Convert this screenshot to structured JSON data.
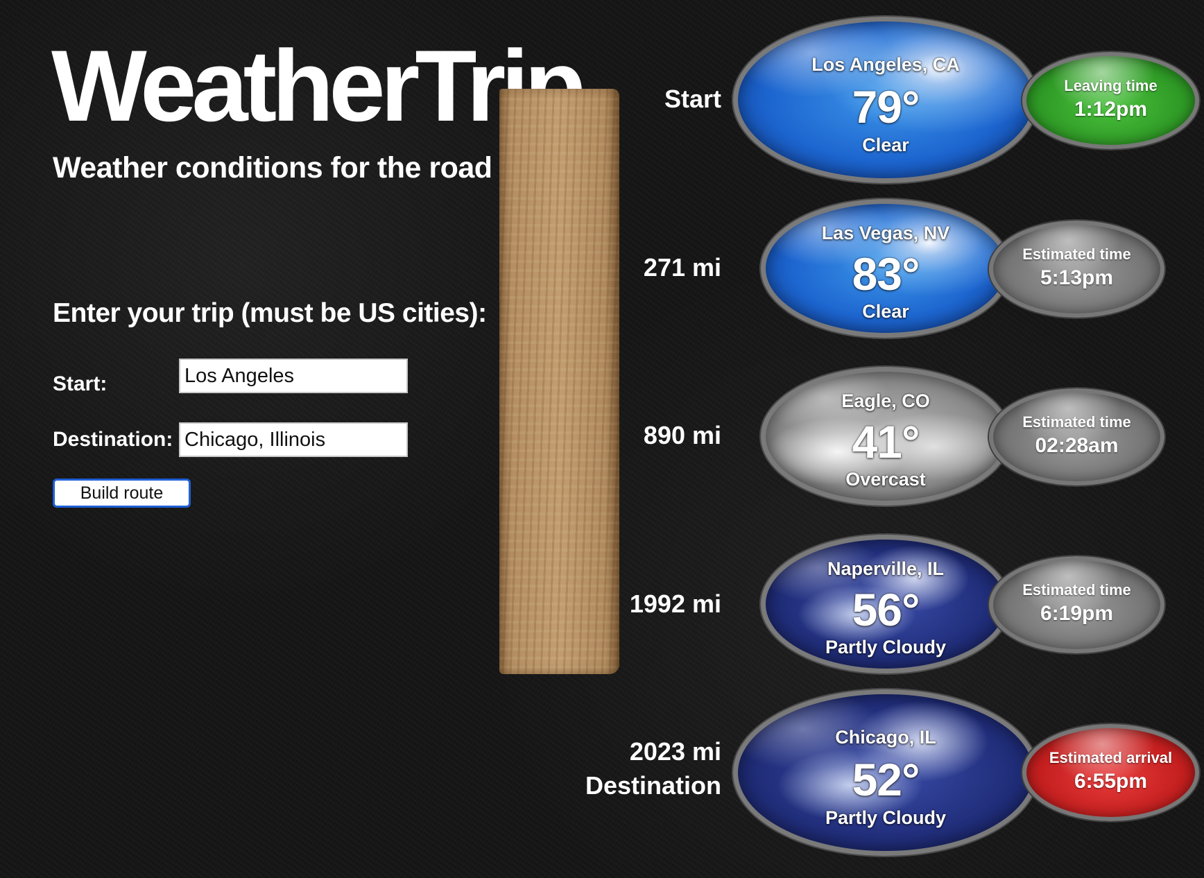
{
  "header": {
    "title": "WeatherTrip",
    "subtitle": "Weather conditions for the road ahead"
  },
  "form": {
    "heading": "Enter your trip (must be US cities):",
    "start_label": "Start:",
    "start_value": "Los Angeles",
    "destination_label": "Destination:",
    "destination_value": "Chicago, Illinois",
    "submit_label": "Build route"
  },
  "stops": [
    {
      "label": "Start",
      "city": "Los Angeles, CA",
      "temp": "79°",
      "condition": "Clear",
      "sky": "clear",
      "time_caption": "Leaving time",
      "time": "1:12pm",
      "time_color": "green"
    },
    {
      "label": "271 mi",
      "city": "Las Vegas, NV",
      "temp": "83°",
      "condition": "Clear",
      "sky": "clear",
      "time_caption": "Estimated time",
      "time": "5:13pm",
      "time_color": "gray"
    },
    {
      "label": "890 mi",
      "city": "Eagle, CO",
      "temp": "41°",
      "condition": "Overcast",
      "sky": "overcast",
      "time_caption": "Estimated time",
      "time": "02:28am",
      "time_color": "gray"
    },
    {
      "label": "1992 mi",
      "city": "Naperville, IL",
      "temp": "56°",
      "condition": "Partly Cloudy",
      "sky": "partly-cloudy",
      "time_caption": "Estimated time",
      "time": "6:19pm",
      "time_color": "gray"
    },
    {
      "label": "2023 mi",
      "label_line2": "Destination",
      "city": "Chicago, IL",
      "temp": "52°",
      "condition": "Partly Cloudy",
      "sky": "partly-cloudy",
      "time_caption": "Estimated arrival",
      "time": "6:55pm",
      "time_color": "red"
    }
  ],
  "colors": {
    "leaving": "#2f9a26",
    "estimated": "#757575",
    "arrival": "#c41f1f",
    "button_border": "#1f5fd6"
  }
}
